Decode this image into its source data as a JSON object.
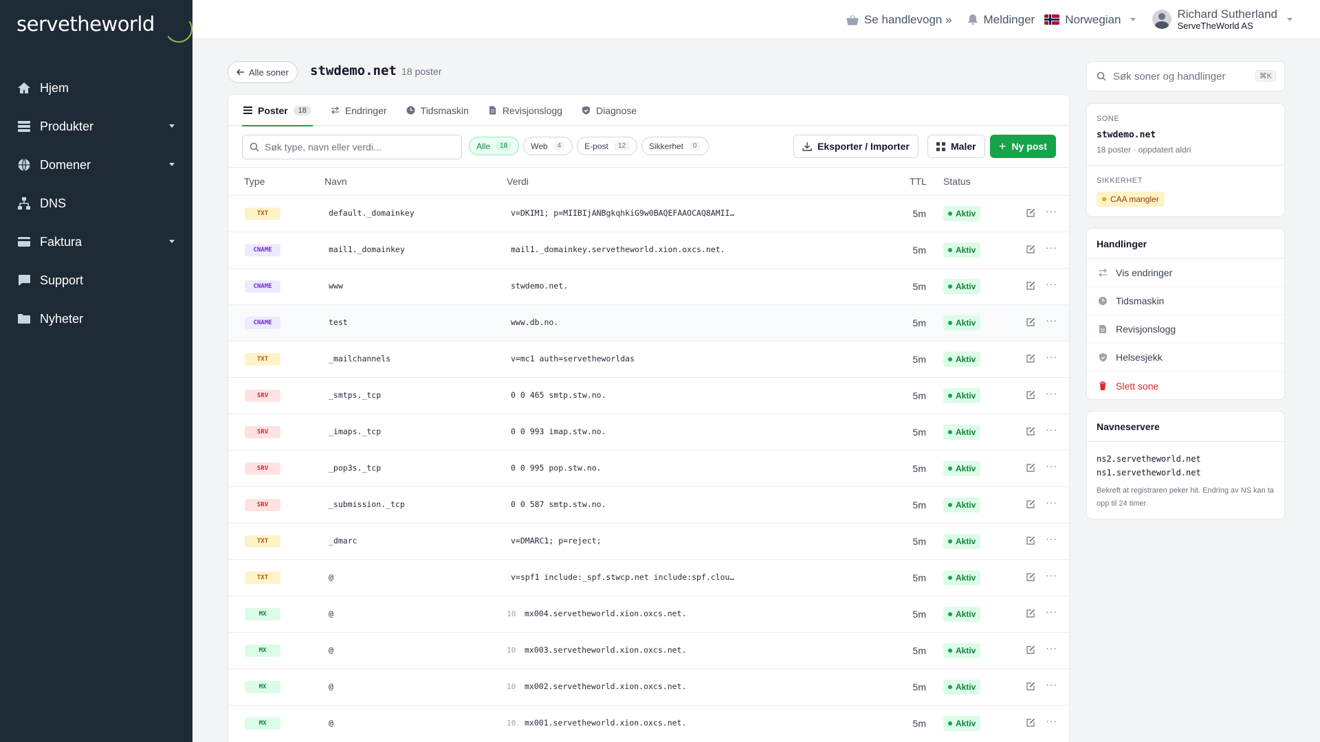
{
  "brand": "servetheworld",
  "sidebar": {
    "items": [
      {
        "label": "Hjem",
        "icon": "home-icon",
        "caret": false
      },
      {
        "label": "Produkter",
        "icon": "server-icon",
        "caret": true
      },
      {
        "label": "Domener",
        "icon": "globe-icon",
        "caret": true
      },
      {
        "label": "DNS",
        "icon": "network-icon",
        "caret": false
      },
      {
        "label": "Faktura",
        "icon": "credit-card-icon",
        "caret": true
      },
      {
        "label": "Support",
        "icon": "chat-icon",
        "caret": false
      },
      {
        "label": "Nyheter",
        "icon": "folder-icon",
        "caret": false
      }
    ]
  },
  "topbar": {
    "cart": "Se handlevogn »",
    "notifications": "Meldinger",
    "language": "Norwegian",
    "user_name": "Richard Sutherland",
    "user_org": "ServeTheWorld AS"
  },
  "header": {
    "back": "Alle soner",
    "zone": "stwdemo.net",
    "count": "18 poster"
  },
  "tabs": [
    {
      "label": "Poster",
      "count": "18",
      "active": true
    },
    {
      "label": "Endringer",
      "count": "",
      "active": false
    },
    {
      "label": "Tidsmaskin",
      "count": "",
      "active": false
    },
    {
      "label": "Revisjonslogg",
      "count": "",
      "active": false
    },
    {
      "label": "Diagnose",
      "count": "",
      "active": false
    }
  ],
  "toolbar": {
    "search_placeholder": "Søk type, navn eller verdi...",
    "chips": [
      {
        "label": "Alle",
        "count": "18",
        "active": true
      },
      {
        "label": "Web",
        "count": "4",
        "active": false
      },
      {
        "label": "E-post",
        "count": "12",
        "active": false
      },
      {
        "label": "Sikkerhet",
        "count": "0",
        "active": false
      }
    ],
    "export_label": "Eksporter / Importer",
    "templates_label": "Maler",
    "new_label": "Ny post"
  },
  "table": {
    "headers": {
      "type": "Type",
      "name": "Navn",
      "value": "Verdi",
      "ttl": "TTL",
      "status": "Status"
    },
    "rows": [
      {
        "type": "TXT",
        "name": "default._domainkey",
        "prio": "",
        "value": "v=DKIM1; p=MIIBIjANBgkqhkiG9w0BAQEFAAOCAQ8AMII…",
        "ttl": "5m",
        "status": "Aktiv"
      },
      {
        "type": "CNAME",
        "name": "mail1._domainkey",
        "prio": "",
        "value": "mail1._domainkey.servetheworld.xion.oxcs.net.",
        "ttl": "5m",
        "status": "Aktiv"
      },
      {
        "type": "CNAME",
        "name": "www",
        "prio": "",
        "value": "stwdemo.net.",
        "ttl": "5m",
        "status": "Aktiv"
      },
      {
        "type": "CNAME",
        "name": "test",
        "prio": "",
        "value": "www.db.no.",
        "ttl": "5m",
        "status": "Aktiv"
      },
      {
        "type": "TXT",
        "name": "_mailchannels",
        "prio": "",
        "value": "v=mc1 auth=servetheworldas",
        "ttl": "5m",
        "status": "Aktiv"
      },
      {
        "type": "SRV",
        "name": "_smtps._tcp",
        "prio": "",
        "value": "0 0 465 smtp.stw.no.",
        "ttl": "5m",
        "status": "Aktiv"
      },
      {
        "type": "SRV",
        "name": "_imaps._tcp",
        "prio": "",
        "value": "0 0 993 imap.stw.no.",
        "ttl": "5m",
        "status": "Aktiv"
      },
      {
        "type": "SRV",
        "name": "_pop3s._tcp",
        "prio": "",
        "value": "0 0 995 pop.stw.no.",
        "ttl": "5m",
        "status": "Aktiv"
      },
      {
        "type": "SRV",
        "name": "_submission._tcp",
        "prio": "",
        "value": "0 0 587 smtp.stw.no.",
        "ttl": "5m",
        "status": "Aktiv"
      },
      {
        "type": "TXT",
        "name": "_dmarc",
        "prio": "",
        "value": "v=DMARC1; p=reject;",
        "ttl": "5m",
        "status": "Aktiv"
      },
      {
        "type": "TXT",
        "name": "@",
        "prio": "",
        "value": "v=spf1 include:_spf.stwcp.net include:spf.clou…",
        "ttl": "5m",
        "status": "Aktiv"
      },
      {
        "type": "MX",
        "name": "@",
        "prio": "10",
        "value": "mx004.servetheworld.xion.oxcs.net.",
        "ttl": "5m",
        "status": "Aktiv"
      },
      {
        "type": "MX",
        "name": "@",
        "prio": "10",
        "value": "mx003.servetheworld.xion.oxcs.net.",
        "ttl": "5m",
        "status": "Aktiv"
      },
      {
        "type": "MX",
        "name": "@",
        "prio": "10",
        "value": "mx002.servetheworld.xion.oxcs.net.",
        "ttl": "5m",
        "status": "Aktiv"
      },
      {
        "type": "MX",
        "name": "@",
        "prio": "10",
        "value": "mx001.servetheworld.xion.oxcs.net.",
        "ttl": "5m",
        "status": "Aktiv"
      }
    ]
  },
  "right": {
    "search_placeholder": "Søk soner og handlinger",
    "shortcut": "⌘K",
    "zone_label": "SONE",
    "zone_name": "stwdemo.net",
    "zone_meta": "18 poster · oppdatert aldri",
    "security_label": "SIKKERHET",
    "security_badge": "CAA mangler",
    "actions_title": "Handlinger",
    "actions": [
      {
        "label": "Vis endringer",
        "icon": "swap-icon",
        "danger": false
      },
      {
        "label": "Tidsmaskin",
        "icon": "clock-icon",
        "danger": false
      },
      {
        "label": "Revisjonslogg",
        "icon": "document-icon",
        "danger": false
      },
      {
        "label": "Helsesjekk",
        "icon": "shield-icon",
        "danger": false
      },
      {
        "label": "Slett sone",
        "icon": "trash-icon",
        "danger": true
      }
    ],
    "ns_title": "Navneservere",
    "ns1": "ns2.servetheworld.net",
    "ns2": "ns1.servetheworld.net",
    "ns_note": "Bekreft at registraren peker hit. Endring av NS kan ta opp til 24 timer."
  },
  "colors": {
    "sidebar": "#1e2a36",
    "accent": "#16a34a",
    "logo_ring": "#8bc34a"
  }
}
